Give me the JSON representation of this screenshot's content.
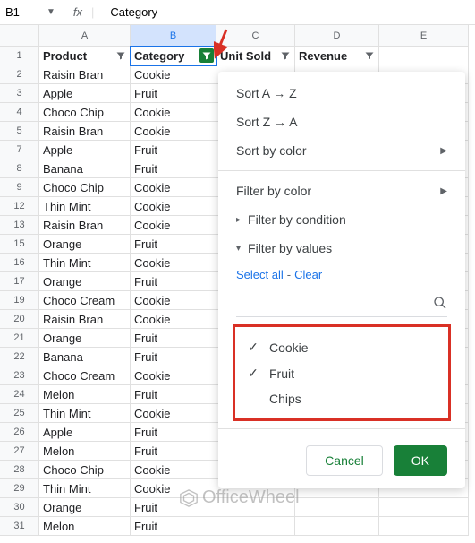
{
  "namebox": {
    "cell": "B1",
    "formula": "Category",
    "fx": "fx"
  },
  "columns": [
    "A",
    "B",
    "C",
    "D",
    "E"
  ],
  "row_numbers": [
    1,
    2,
    3,
    4,
    5,
    7,
    8,
    9,
    12,
    13,
    15,
    16,
    17,
    19,
    20,
    21,
    22,
    23,
    24,
    25,
    26,
    27,
    28,
    29,
    30,
    31
  ],
  "headers": {
    "a": "Product",
    "b": "Category",
    "c": "Unit Sold",
    "d": "Revenue"
  },
  "rows": [
    {
      "a": "Raisin Bran",
      "b": "Cookie"
    },
    {
      "a": "Apple",
      "b": "Fruit"
    },
    {
      "a": "Choco Chip",
      "b": "Cookie"
    },
    {
      "a": "Raisin Bran",
      "b": "Cookie"
    },
    {
      "a": "Apple",
      "b": "Fruit"
    },
    {
      "a": "Banana",
      "b": "Fruit"
    },
    {
      "a": "Choco Chip",
      "b": "Cookie"
    },
    {
      "a": "Thin Mint",
      "b": "Cookie"
    },
    {
      "a": "Raisin Bran",
      "b": "Cookie"
    },
    {
      "a": "Orange",
      "b": "Fruit"
    },
    {
      "a": "Thin Mint",
      "b": "Cookie"
    },
    {
      "a": "Orange",
      "b": "Fruit"
    },
    {
      "a": "Choco Cream",
      "b": "Cookie"
    },
    {
      "a": "Raisin Bran",
      "b": "Cookie"
    },
    {
      "a": "Orange",
      "b": "Fruit"
    },
    {
      "a": "Banana",
      "b": "Fruit"
    },
    {
      "a": "Choco Cream",
      "b": "Cookie"
    },
    {
      "a": "Melon",
      "b": "Fruit"
    },
    {
      "a": "Thin Mint",
      "b": "Cookie"
    },
    {
      "a": "Apple",
      "b": "Fruit"
    },
    {
      "a": "Melon",
      "b": "Fruit"
    },
    {
      "a": "Choco Chip",
      "b": "Cookie"
    },
    {
      "a": "Thin Mint",
      "b": "Cookie"
    },
    {
      "a": "Orange",
      "b": "Fruit"
    },
    {
      "a": "Melon",
      "b": "Fruit"
    }
  ],
  "menu": {
    "sort_az": "Sort A → Z",
    "sort_za": "Sort Z → A",
    "sort_color": "Sort by color",
    "filter_color": "Filter by color",
    "filter_condition": "Filter by condition",
    "filter_values": "Filter by values",
    "select_all": "Select all",
    "clear": "Clear",
    "values": [
      {
        "label": "Cookie",
        "checked": true
      },
      {
        "label": "Fruit",
        "checked": true
      },
      {
        "label": "Chips",
        "checked": false
      }
    ],
    "cancel": "Cancel",
    "ok": "OK"
  },
  "watermark": "OfficeWheel"
}
